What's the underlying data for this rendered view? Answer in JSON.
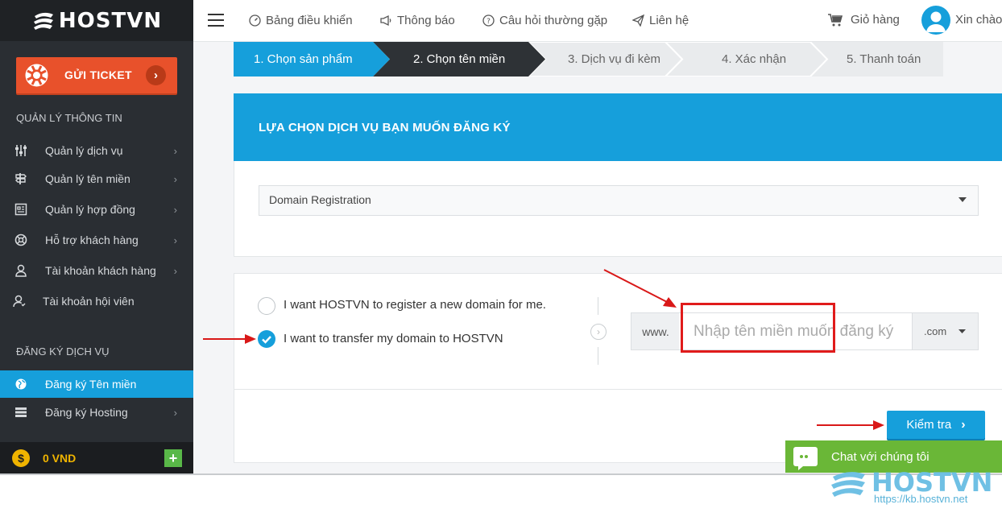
{
  "brand": {
    "logo_text": "HOSTVN"
  },
  "sidebar": {
    "ticket_label": "GỬI TICKET",
    "section_info": "QUẢN LÝ THÔNG TIN",
    "info_items": [
      {
        "label": "Quản lý dịch vụ",
        "icon": "sliders-icon"
      },
      {
        "label": "Quản lý tên miền",
        "icon": "signpost-icon"
      },
      {
        "label": "Quản lý hợp đồng",
        "icon": "contract-icon"
      },
      {
        "label": "Hỗ trợ khách hàng",
        "icon": "lifebuoy-icon"
      },
      {
        "label": "Tài khoản khách hàng",
        "icon": "user-icon"
      },
      {
        "label": "Tài khoản hội viên",
        "icon": "member-icon"
      }
    ],
    "section_register": "ĐĂNG KÝ DỊCH VỤ",
    "register_items": [
      {
        "label": "Đăng ký Tên miền",
        "icon": "globe-icon",
        "active": true
      },
      {
        "label": "Đăng ký Hosting",
        "icon": "server-icon",
        "active": false
      }
    ],
    "balance": "0 VND"
  },
  "topbar": {
    "dashboard": "Bảng điều khiển",
    "notifications": "Thông báo",
    "faq": "Câu hỏi thường gặp",
    "contact": "Liên hệ",
    "cart": "Giỏ hàng",
    "greeting": "Xin chào,"
  },
  "steps": [
    {
      "label": "1. Chọn sản phẩm",
      "state": "done"
    },
    {
      "label": "2. Chọn tên miền",
      "state": "current"
    },
    {
      "label": "3. Dịch vụ đi kèm",
      "state": "todo"
    },
    {
      "label": "4. Xác nhận",
      "state": "todo"
    },
    {
      "label": "5. Thanh toán",
      "state": "todo"
    }
  ],
  "main": {
    "section_title": "LỰA CHỌN DỊCH VỤ BẠN MUỐN ĐĂNG KÝ",
    "service_select": "Domain Registration",
    "option_register": "I want HOSTVN to register a new domain for me.",
    "option_transfer": "I want to transfer my domain to HOSTVN",
    "selected_option": "transfer",
    "www_prefix": "www.",
    "domain_placeholder": "Nhập tên miền muốn đăng ký",
    "tld": ".com",
    "check_button": "Kiểm tra"
  },
  "chat": {
    "label": "Chat với chúng tôi"
  },
  "watermark": {
    "logo": "HOSTVN",
    "url": "https://kb.hostvn.net"
  },
  "colors": {
    "primary": "#169fdb",
    "sidebar": "#2a2e33",
    "ticket": "#e8512b",
    "chat": "#6ab737",
    "annotation": "#e01b1b",
    "balance": "#f0b400"
  }
}
